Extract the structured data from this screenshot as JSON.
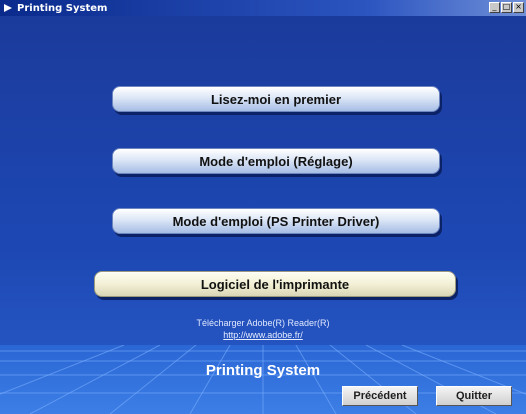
{
  "window": {
    "title": "Printing System"
  },
  "menu": {
    "readme": "Lisez-moi en premier",
    "manual_setup": "Mode d'emploi (Réglage)",
    "manual_driver": "Mode d'emploi (PS Printer Driver)",
    "software": "Logiciel de l'imprimante"
  },
  "download": {
    "text": "Télécharger Adobe(R) Reader(R)",
    "link": "http://www.adobe.fr/"
  },
  "footer": {
    "brand": "Printing System",
    "previous": "Précédent",
    "quit": "Quitter"
  },
  "colors": {
    "background": "#1d48b4",
    "button_face": "#dce6f6",
    "software_button_face": "#f3f0d6",
    "title_bar": "#0a2a8c"
  }
}
